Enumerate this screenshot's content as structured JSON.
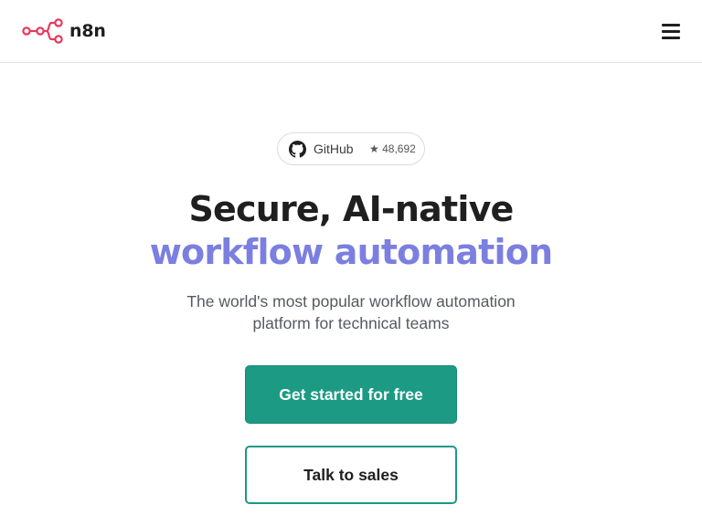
{
  "header": {
    "brand": "n8n",
    "logo_icon": "n8n-logo-icon",
    "menu_icon": "hamburger-menu-icon"
  },
  "github": {
    "label": "GitHub",
    "stars": "★ 48,692",
    "icon": "github-icon"
  },
  "hero": {
    "headline_line1": "Secure, AI-native",
    "headline_line2": "workflow automation",
    "subtitle_line1": "The world's most popular workflow automation",
    "subtitle_line2": "platform for technical teams"
  },
  "actions": {
    "primary_label": "Get started for free",
    "secondary_label": "Talk to sales"
  },
  "colors": {
    "brand_logo": "#e9385e",
    "accent_purple": "#7b7fe0",
    "primary_green": "#1c9a84"
  }
}
